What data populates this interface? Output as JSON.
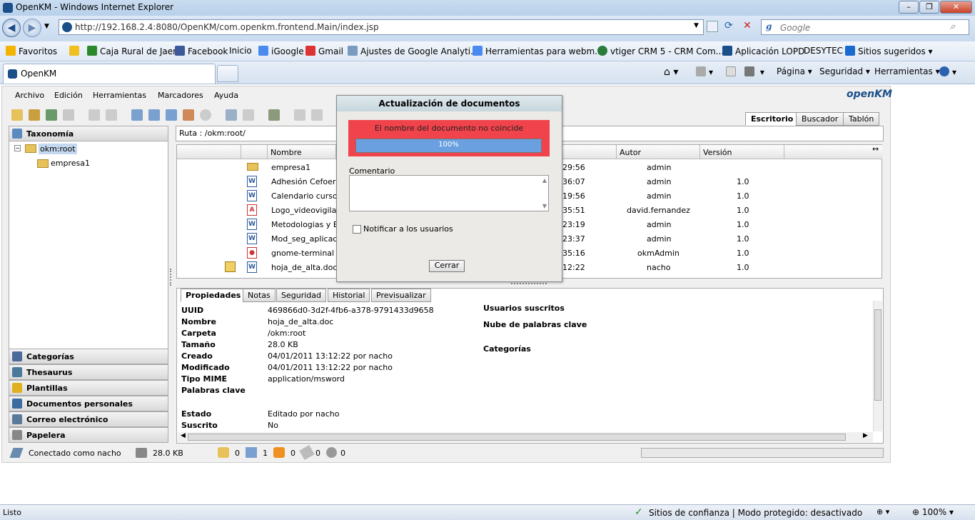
{
  "window": {
    "title": "OpenKM - Windows Internet Explorer"
  },
  "address": {
    "url": "http://192.168.2.4:8080/OpenKM/com.openkm.frontend.Main/index.jsp",
    "search_placeholder": "Google"
  },
  "favorites": {
    "label": "Favoritos",
    "items": [
      "Caja Rural de Jaen",
      "Facebook",
      "Inicio",
      "iGoogle",
      "Gmail",
      "Ajustes de Google Analyti...",
      "Herramientas para webm...",
      "vtiger CRM 5 - CRM Com...",
      "Aplicación LOPD",
      "DESYTEC",
      "Sitios sugeridos"
    ]
  },
  "tab": {
    "label": "OpenKM"
  },
  "commandbar": {
    "page": "Página",
    "security": "Seguridad",
    "tools": "Herramientas"
  },
  "app": {
    "menu": [
      "Archivo",
      "Edición",
      "Herramientas",
      "Marcadores",
      "Ayuda"
    ],
    "logo": "openKM",
    "workspace_tabs": [
      "Escritorio",
      "Buscador",
      "Tablón"
    ],
    "left": {
      "header": "Taxonomía",
      "tree": {
        "root": "okm:root",
        "child": "empresa1"
      },
      "stacks": [
        "Categorías",
        "Thesaurus",
        "Plantillas",
        "Documentos personales",
        "Correo electrónico",
        "Papelera"
      ]
    },
    "path": "Ruta : /okm:root/",
    "grid": {
      "headers": {
        "name": "Nombre",
        "author": "Autor",
        "version": "Versión"
      },
      "rows": [
        {
          "name": "empresa1",
          "time": "29:56",
          "author": "admin",
          "version": ""
        },
        {
          "name": "Adhesión Cefoer",
          "time": "36:07",
          "author": "admin",
          "version": "1.0"
        },
        {
          "name": "Calendario curso",
          "time": "19:56",
          "author": "admin",
          "version": "1.0"
        },
        {
          "name": "Logo_videovigila",
          "time": "35:51",
          "author": "david.fernandez",
          "version": "1.0"
        },
        {
          "name": "Metodologias y E",
          "time": "23:19",
          "author": "admin",
          "version": "1.0"
        },
        {
          "name": "Mod_seg_aplicac",
          "time": "23:37",
          "author": "admin",
          "version": "1.0"
        },
        {
          "name": "gnome-terminal",
          "time": "35:16",
          "author": "okmAdmin",
          "version": "1.0"
        },
        {
          "name": "hoja_de_alta.doc",
          "time": "12:22",
          "author": "nacho",
          "version": "1.0"
        }
      ]
    },
    "props_tabs": [
      "Propiedades",
      "Notas",
      "Seguridad",
      "Historial",
      "Previsualizar"
    ],
    "props": {
      "uuid_k": "UUID",
      "uuid": "469866d0-3d2f-4fb6-a378-9791433d9658",
      "nombre_k": "Nombre",
      "nombre": "hoja_de_alta.doc",
      "carpeta_k": "Carpeta",
      "carpeta": "/okm:root",
      "tamano_k": "Tamaño",
      "tamano": "28.0 KB",
      "creado_k": "Creado",
      "creado": "04/01/2011 13:12:22 por nacho",
      "modificado_k": "Modificado",
      "modificado": "04/01/2011 13:12:22 por nacho",
      "mime_k": "Tipo MIME",
      "mime": "application/msword",
      "palabras_k": "Palabras clave",
      "estado_k": "Estado",
      "estado": "Editado por nacho",
      "suscrito_k": "Suscrito",
      "suscrito": "No",
      "usuarios_suscritos": "Usuarios suscritos",
      "nube": "Nube de palabras clave",
      "categorias": "Categorías"
    },
    "status": {
      "connected": "Conectado como nacho",
      "size": "28.0 KB",
      "counts": [
        "0",
        "1",
        "0",
        "0",
        "0"
      ]
    }
  },
  "dialog": {
    "title": "Actualización de documentos",
    "error": "El nombre del documento no coincide",
    "progress_label": "100%",
    "progress": 1.0,
    "comment_label": "Comentario",
    "notify_label": "Notificar a los usuarios",
    "close_button": "Cerrar"
  },
  "iestatus": {
    "left": "Listo",
    "zone": "Sitios de confianza | Modo protegido: desactivado",
    "zoom": "100%"
  }
}
